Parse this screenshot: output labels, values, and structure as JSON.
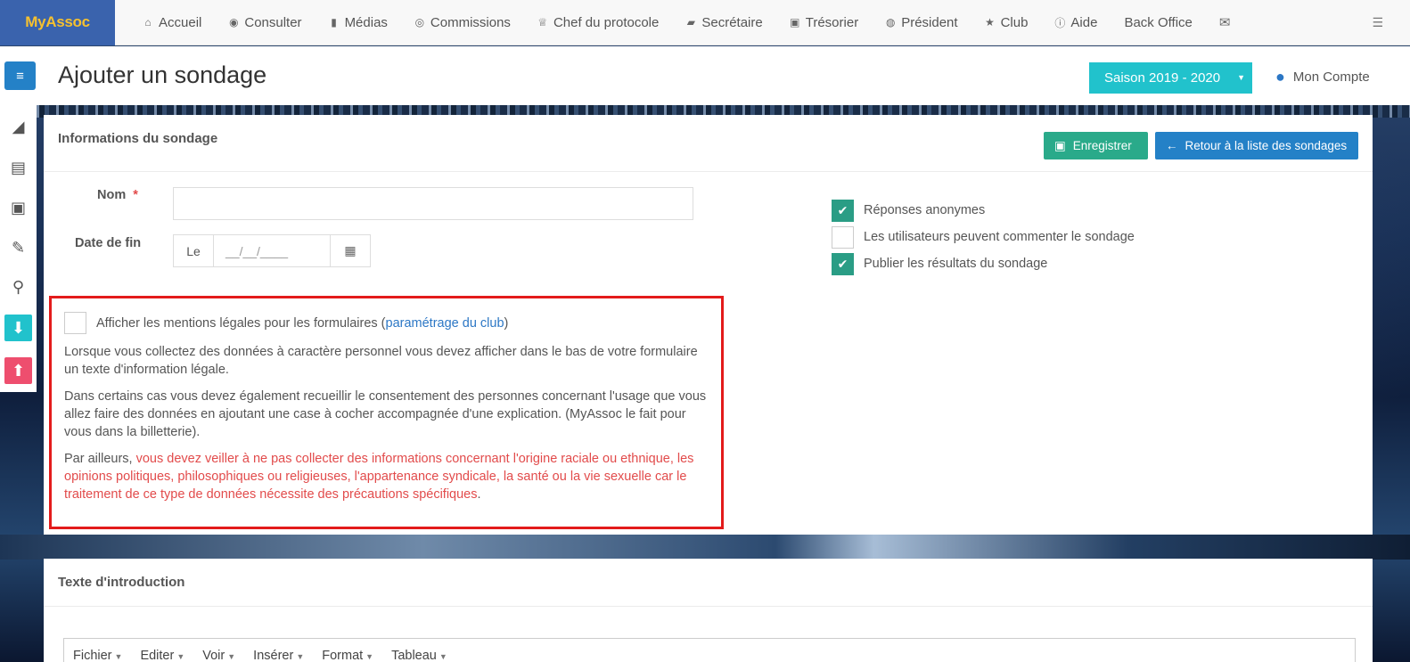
{
  "brand": "MyAssoc",
  "nav": [
    {
      "label": "Accueil",
      "icon": "home-icon",
      "glyph": "⌂"
    },
    {
      "label": "Consulter",
      "icon": "eye-icon",
      "glyph": "◉"
    },
    {
      "label": "Médias",
      "icon": "file-icon",
      "glyph": "▮"
    },
    {
      "label": "Commissions",
      "icon": "user-circle-icon",
      "glyph": "◎"
    },
    {
      "label": "Chef du protocole",
      "icon": "trophy-icon",
      "glyph": "♕"
    },
    {
      "label": "Secrétaire",
      "icon": "book-icon",
      "glyph": "▰"
    },
    {
      "label": "Trésorier",
      "icon": "money-icon",
      "glyph": "▣"
    },
    {
      "label": "Président",
      "icon": "globe-icon",
      "glyph": "◍"
    },
    {
      "label": "Club",
      "icon": "star-icon",
      "glyph": "★"
    },
    {
      "label": "Aide",
      "icon": "info-icon",
      "glyph": "ⓘ"
    },
    {
      "label": "Back Office",
      "icon": "",
      "glyph": ""
    },
    {
      "label": "",
      "icon": "envelope-icon",
      "glyph": "✉"
    }
  ],
  "nav_right_icon": "☰",
  "page_title": "Ajouter un sondage",
  "season": "Saison 2019 - 2020",
  "account": "Mon Compte",
  "sidebar_icons": {
    "chart": "◢",
    "doc": "▤",
    "money": "▣",
    "wrench": "✎",
    "marker": "⚲",
    "download": "⬇",
    "upload": "⬆"
  },
  "card": {
    "title": "Informations du sondage",
    "save_label": "Enregistrer",
    "back_label": "Retour à la liste des sondages",
    "name_label": "Nom",
    "required_mark": "*",
    "name_value": "",
    "date_label": "Date de fin",
    "date_prefix": "Le",
    "date_placeholder": "__/__/____"
  },
  "options": [
    {
      "label": "Réponses anonymes",
      "checked": true
    },
    {
      "label": "Les utilisateurs peuvent commenter le sondage",
      "checked": false
    },
    {
      "label": "Publier les résultats du sondage",
      "checked": true
    }
  ],
  "legal": {
    "checkbox_label_pre": "Afficher les mentions légales pour les formulaires (",
    "checkbox_link": "paramétrage du club",
    "checkbox_label_post": ")",
    "checked": false,
    "p1": "Lorsque vous collectez des données à caractère personnel vous devez afficher dans le bas de votre formulaire un texte d'information légale.",
    "p2": "Dans certains cas vous devez également recueillir le consentement des personnes concernant l'usage que vous allez faire des données en ajoutant une case à cocher accompagnée d'une explication. (MyAssoc le fait pour vous dans la billetterie).",
    "p3_pre": "Par ailleurs, ",
    "p3_warn": "vous devez veiller à ne pas collecter des informations concernant l'origine raciale ou ethnique, les opinions politiques, philosophiques ou religieuses, l'appartenance syndicale, la santé ou la vie sexuelle car le traitement de ce type de données nécessite des précautions spécifiques",
    "p3_post": "."
  },
  "card2": {
    "title": "Texte d'introduction",
    "menu": [
      "Fichier",
      "Editer",
      "Voir",
      "Insérer",
      "Format",
      "Tableau"
    ]
  },
  "colors": {
    "brand_bg": "#3a63ad",
    "brand_text": "#f6c12f",
    "teal": "#21c2cc",
    "save_green": "#2aaa8a",
    "primary_blue": "#2481c7",
    "warning_red": "#e24b4b",
    "highlight_border": "#e31b1b"
  }
}
